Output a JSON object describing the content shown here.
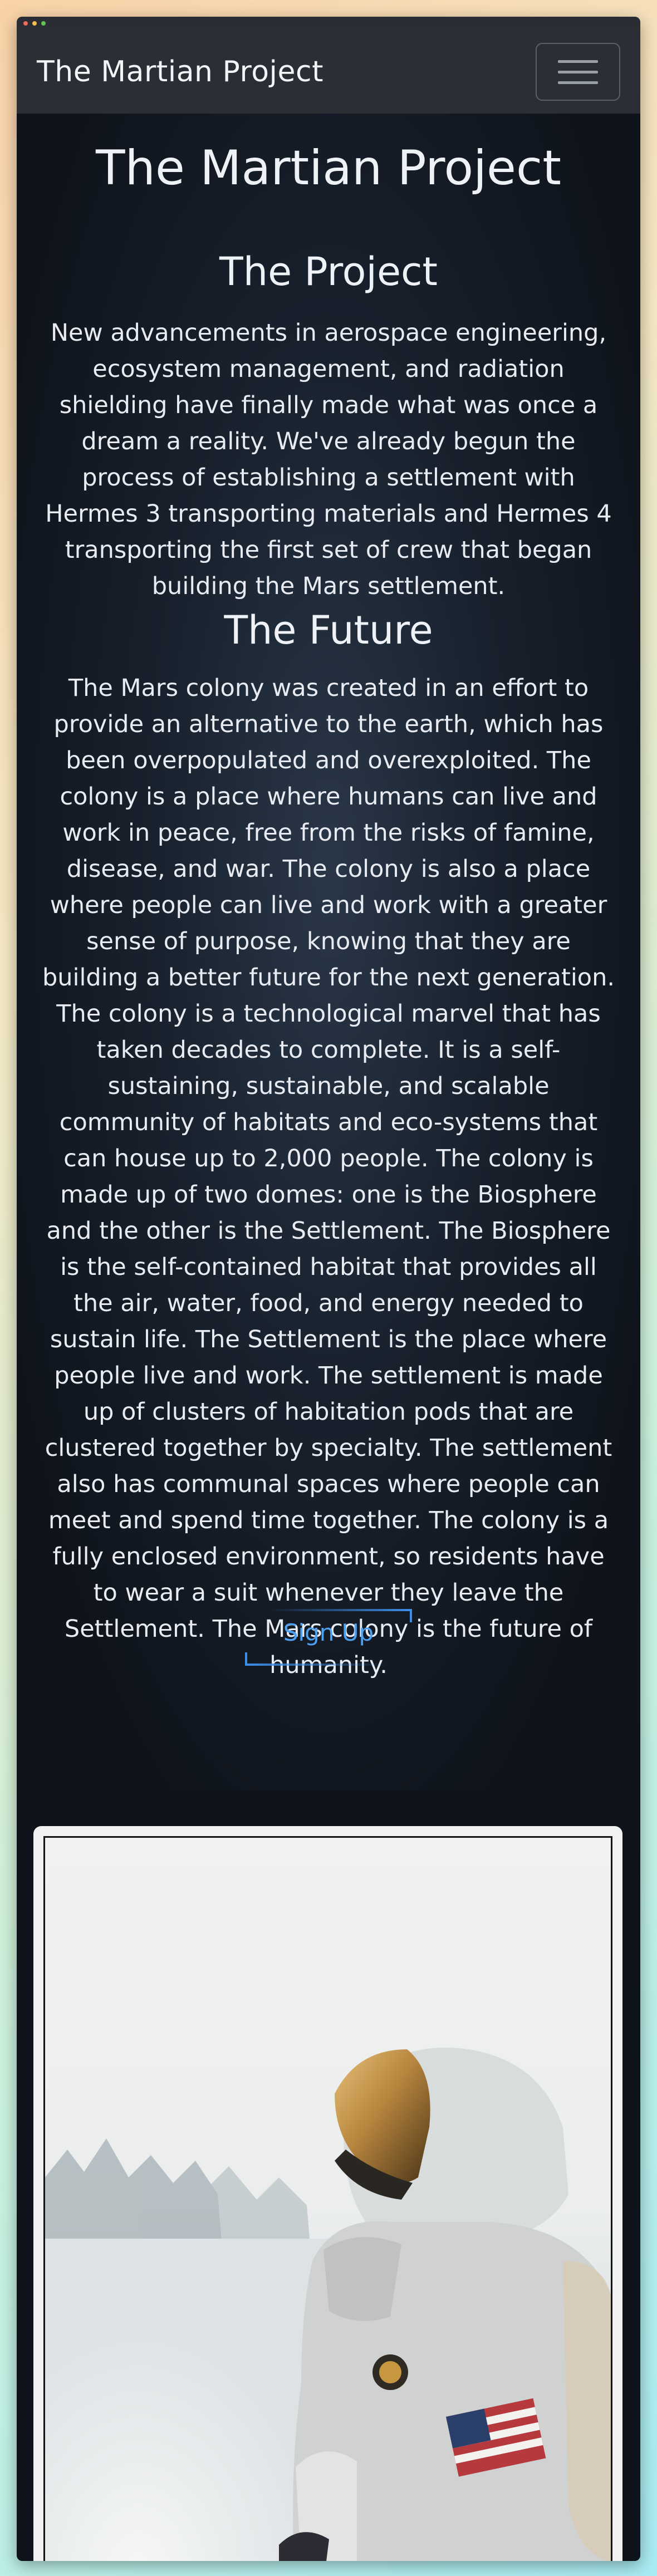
{
  "navbar": {
    "brand": "The Martian Project",
    "toggle_icon": "hamburger-menu-icon"
  },
  "main": {
    "title": "The Martian Project",
    "project": {
      "heading": "The Project",
      "text": "New advancements in aerospace engineering, ecosystem management, and radiation shielding have finally made what was once a dream a reality. We've already begun the process of establishing a settlement with Hermes 3 transporting materials and Hermes 4 transporting the first set of crew that began building the Mars settlement."
    },
    "future": {
      "heading": "The Future",
      "text": "The Mars colony was created in an effort to provide an alternative to the earth, which has been overpopulated and overexploited. The colony is a place where humans can live and work in peace, free from the risks of famine, disease, and war. The colony is also a place where people can live and work with a greater sense of purpose, knowing that they are building a better future for the next generation. The colony is a technological marvel that has taken decades to complete. It is a self-sustaining, sustainable, and scalable community of habitats and eco-systems that can house up to 2,000 people. The colony is made up of two domes: one is the Biosphere and the other is the Settlement. The Biosphere is the self-contained habitat that provides all the air, water, food, and energy needed to sustain life. The Settlement is the place where people live and work. The settlement is made up of clusters of habitation pods that are clustered together by specialty. The settlement also has communal spaces where people can meet and spend time together. The colony is a fully enclosed environment, so residents have to wear a suit whenever they leave the Settlement. The Mars colony is the future of humanity."
    },
    "signup_label": "Sign Up"
  },
  "colors": {
    "page_bg": "#0f141c",
    "navbar_bg": "#2b2f35",
    "accent": "#3d8ee8"
  }
}
